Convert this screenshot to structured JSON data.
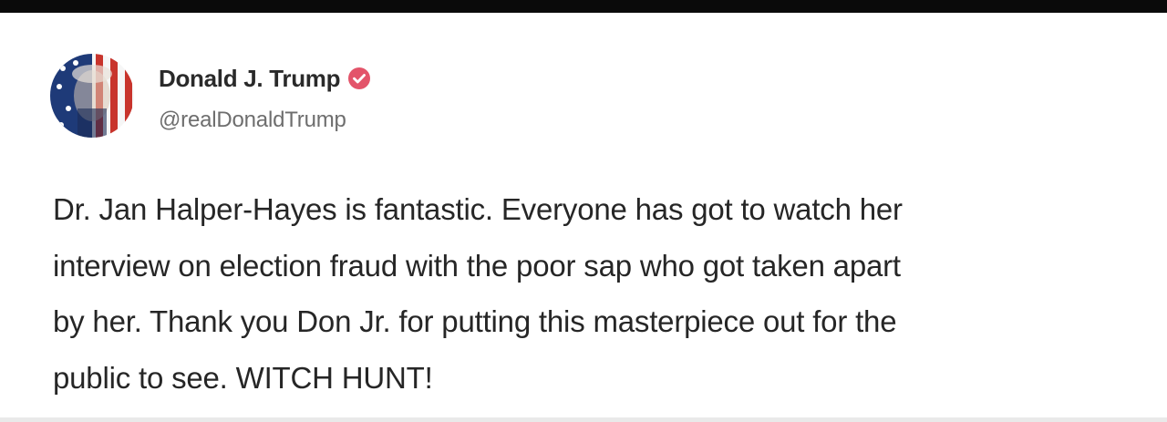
{
  "post": {
    "author": {
      "display_name": "Donald J. Trump",
      "handle": "@realDonaldTrump",
      "verified": true,
      "verified_color": "#e3546a"
    },
    "avatar_icon": "flag-portrait-avatar",
    "text": "Dr. Jan Halper-Hayes is fantastic. Everyone has got to watch her\ninterview on election fraud with the poor sap who got taken apart\nby her. Thank you Don Jr. for putting this masterpiece out for the\npublic to see. WITCH HUNT!"
  }
}
